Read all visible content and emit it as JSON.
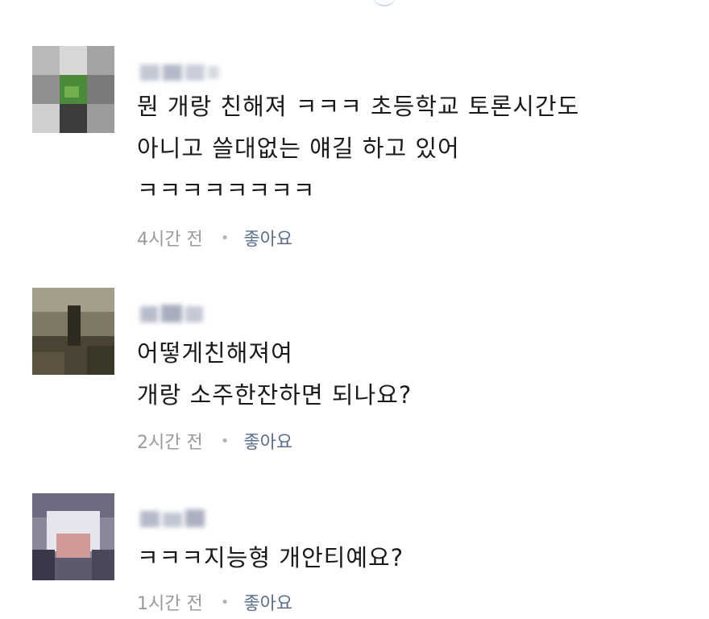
{
  "comments": [
    {
      "text": "뭔 개랑 친해져 ㅋㅋㅋ 초등학교 토론시간도\n아니고 쓸대없는 얘길 하고 있어\nㅋㅋㅋㅋㅋㅋㅋㅋ",
      "time": "4시간 전",
      "like": "좋아요"
    },
    {
      "text": "어떻게친해져여\n개랑 소주한잔하면 되나요?",
      "time": "2시간 전",
      "like": "좋아요"
    },
    {
      "text": "ㅋㅋㅋ지능형 개안티예요?",
      "time": "1시간 전",
      "like": "좋아요"
    }
  ],
  "separator": "•"
}
